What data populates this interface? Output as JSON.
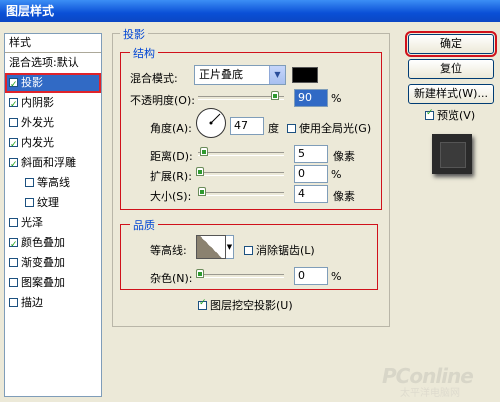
{
  "window": {
    "title": "图层样式"
  },
  "styles_panel": {
    "header": "样式",
    "blend_options": "混合选项:默认",
    "items": [
      {
        "label": "投影",
        "checked": true,
        "selected": true,
        "indent": false
      },
      {
        "label": "内阴影",
        "checked": true,
        "selected": false,
        "indent": false
      },
      {
        "label": "外发光",
        "checked": false,
        "selected": false,
        "indent": false
      },
      {
        "label": "内发光",
        "checked": true,
        "selected": false,
        "indent": false
      },
      {
        "label": "斜面和浮雕",
        "checked": true,
        "selected": false,
        "indent": false
      },
      {
        "label": "等高线",
        "checked": false,
        "selected": false,
        "indent": true
      },
      {
        "label": "纹理",
        "checked": false,
        "selected": false,
        "indent": true
      },
      {
        "label": "光泽",
        "checked": false,
        "selected": false,
        "indent": false
      },
      {
        "label": "颜色叠加",
        "checked": true,
        "selected": false,
        "indent": false
      },
      {
        "label": "渐变叠加",
        "checked": false,
        "selected": false,
        "indent": false
      },
      {
        "label": "图案叠加",
        "checked": false,
        "selected": false,
        "indent": false
      },
      {
        "label": "描边",
        "checked": false,
        "selected": false,
        "indent": false
      }
    ]
  },
  "drop_shadow": {
    "title": "投影",
    "structure": {
      "title": "结构",
      "blend_mode_label": "混合模式:",
      "blend_mode_value": "正片叠底",
      "shadow_color": "#000000",
      "opacity_label": "不透明度(O):",
      "opacity_value": "90",
      "percent": "%",
      "angle_label": "角度(A):",
      "angle_value": "47",
      "degree": "度",
      "global_light_label": "使用全局光(G)",
      "global_light_checked": false,
      "distance_label": "距离(D):",
      "distance_value": "5",
      "spread_label": "扩展(R):",
      "spread_value": "0",
      "size_label": "大小(S):",
      "size_value": "4",
      "pixels": "像素"
    },
    "quality": {
      "title": "品质",
      "contour_label": "等高线:",
      "anti_alias_label": "消除锯齿(L)",
      "anti_alias_checked": false,
      "noise_label": "杂色(N):",
      "noise_value": "0",
      "percent": "%"
    },
    "knockout_label": "图层挖空投影(U)",
    "knockout_checked": true
  },
  "buttons": {
    "ok": "确定",
    "reset": "复位",
    "new_style": "新建样式(W)...",
    "preview_label": "预览(V)",
    "preview_checked": true
  },
  "watermark": {
    "brand": "PConline",
    "sub": "太平洋电脑网"
  }
}
